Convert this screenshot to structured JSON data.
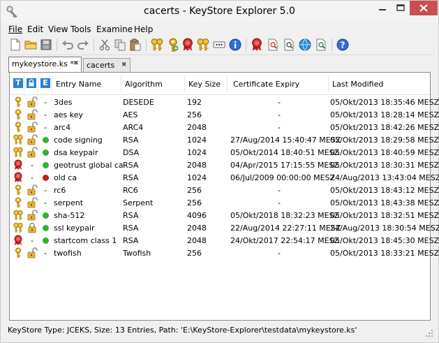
{
  "window": {
    "title": "cacerts - KeyStore Explorer 5.0"
  },
  "menu": [
    {
      "label": "File"
    },
    {
      "label": "Edit"
    },
    {
      "label": "View"
    },
    {
      "label": "Tools"
    },
    {
      "label": "Examine"
    },
    {
      "label": "Help"
    }
  ],
  "tabs": [
    {
      "label": "mykeystore.ks *",
      "active": true
    },
    {
      "label": "cacerts",
      "active": false
    }
  ],
  "columns": {
    "type_icon": "T",
    "lock_icon": "lock-icon",
    "expiry_icon": "E",
    "entry_name": "Entry Name",
    "algorithm": "Algorithm",
    "key_size": "Key Size",
    "cert_expiry": "Certificate Expiry",
    "last_modified": "Last Modified"
  },
  "entries": [
    {
      "type": "key",
      "locked": false,
      "status": "-",
      "name": "3des",
      "algorithm": "DESEDE",
      "key_size": "192",
      "expiry": "-",
      "modified": "05/Okt/2013 18:35:46 MESZ"
    },
    {
      "type": "key",
      "locked": false,
      "status": "-",
      "name": "aes key",
      "algorithm": "AES",
      "key_size": "256",
      "expiry": "-",
      "modified": "05/Okt/2013 18:28:14 MESZ"
    },
    {
      "type": "key",
      "locked": false,
      "status": "-",
      "name": "arc4",
      "algorithm": "ARC4",
      "key_size": "2048",
      "expiry": "-",
      "modified": "05/Okt/2013 18:42:26 MESZ"
    },
    {
      "type": "keypair",
      "locked": false,
      "status": "green",
      "name": "code signing",
      "algorithm": "RSA",
      "key_size": "1024",
      "expiry": "27/Aug/2014 15:40:47 MESZ",
      "modified": "05/Okt/2013 18:29:58 MESZ"
    },
    {
      "type": "keypair",
      "locked": false,
      "status": "green",
      "name": "dsa keypair",
      "algorithm": "DSA",
      "key_size": "1024",
      "expiry": "05/Okt/2014 18:40:51 MESZ",
      "modified": "05/Okt/2013 18:40:59 MESZ"
    },
    {
      "type": "cert",
      "locked": null,
      "status": "green",
      "name": "geotrust global ca",
      "algorithm": "RSA",
      "key_size": "2048",
      "expiry": "04/Apr/2015 17:15:55 MESZ",
      "modified": "05/Okt/2013 18:30:31 MESZ"
    },
    {
      "type": "cert",
      "locked": null,
      "status": "red",
      "name": "old ca",
      "algorithm": "RSA",
      "key_size": "1024",
      "expiry": "06/Jul/2009 00:00:00 MESZ",
      "modified": "24/Aug/2013 13:43:04 MESZ"
    },
    {
      "type": "key",
      "locked": false,
      "status": "-",
      "name": "rc6",
      "algorithm": "RC6",
      "key_size": "256",
      "expiry": "-",
      "modified": "05/Okt/2013 18:43:12 MESZ"
    },
    {
      "type": "key",
      "locked": false,
      "status": "-",
      "name": "serpent",
      "algorithm": "Serpent",
      "key_size": "256",
      "expiry": "-",
      "modified": "05/Okt/2013 18:43:38 MESZ"
    },
    {
      "type": "keypair",
      "locked": false,
      "status": "green",
      "name": "sha-512",
      "algorithm": "RSA",
      "key_size": "4096",
      "expiry": "05/Okt/2018 18:32:23 MESZ",
      "modified": "05/Okt/2013 18:32:51 MESZ"
    },
    {
      "type": "keypair",
      "locked": true,
      "status": "green",
      "name": "ssl keypair",
      "algorithm": "RSA",
      "key_size": "2048",
      "expiry": "22/Aug/2014 22:27:11 MESZ",
      "modified": "24/Aug/2013 18:30:54 MESZ"
    },
    {
      "type": "cert",
      "locked": null,
      "status": "green",
      "name": "startcom class 1",
      "algorithm": "RSA",
      "key_size": "2048",
      "expiry": "24/Okt/2017 22:54:17 MESZ",
      "modified": "05/Okt/2013 18:45:30 MESZ"
    },
    {
      "type": "key",
      "locked": false,
      "status": "-",
      "name": "twofish",
      "algorithm": "Twofish",
      "key_size": "256",
      "expiry": "-",
      "modified": "05/Okt/2013 18:33:21 MESZ"
    }
  ],
  "status_bar": {
    "text": "KeyStore Type: JCEKS, Size: 13 Entries, Path: 'E:\\KeyStore-Explorer\\testdata\\mykeystore.ks'"
  },
  "colors": {
    "key_gold": "#d9a520",
    "cert_red": "#cc2a2a",
    "status_green": "#2fb22f",
    "status_red": "#c41e1e",
    "close_red": "#c75050",
    "header_blue": "#2f7fd6"
  }
}
